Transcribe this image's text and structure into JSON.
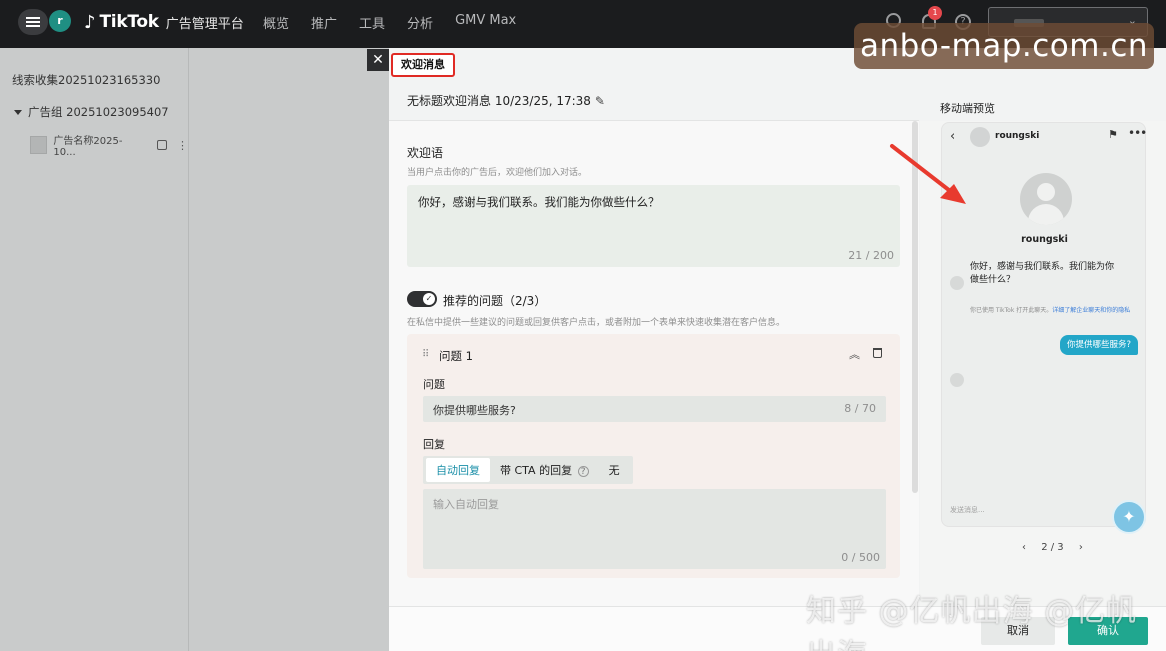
{
  "topbar": {
    "avatar_letter": "r",
    "brand": "TikTok",
    "brand_sub": "广告管理平台",
    "nav": [
      "概览",
      "推广",
      "工具",
      "分析",
      "GMV Max"
    ],
    "notification_count": "1"
  },
  "watermark_badge": "anbo-map.com.cn",
  "tree": {
    "campaign": "线索收集20251023165330",
    "ad_group": "广告组 20251023095407",
    "ad": "广告名称2025-10..."
  },
  "drawer": {
    "tab_label": "欢迎消息",
    "title": "无标题欢迎消息 10/23/25, 17:38",
    "welcome": {
      "label": "欢迎语",
      "hint": "当用户点击你的广告后，欢迎他们加入对话。",
      "text": "你好，感谢与我们联系。我们能为你做些什么？",
      "count": "21 / 200"
    },
    "suggested": {
      "label": "推荐的问题（2/3）",
      "hint": "在私信中提供一些建议的问题或回复供客户点击，或者附加一个表单来快速收集潜在客户信息。",
      "enabled": true
    },
    "question_card": {
      "title": "问题 1",
      "question_label": "问题",
      "question_value": "你提供哪些服务?",
      "question_count": "8 / 70",
      "reply_label": "回复",
      "reply_tabs": [
        "自动回复",
        "带 CTA 的回复",
        "无"
      ],
      "reply_placeholder": "输入自动回复",
      "reply_count": "0 / 500"
    },
    "footer": {
      "cancel": "取消",
      "confirm": "确认"
    }
  },
  "preview": {
    "label": "移动端预览",
    "username": "roungski",
    "message": "你好，感谢与我们联系。我们能为你做些什么？",
    "note_prefix": "你已使用 TikTok 打开此聊天。",
    "note_link": "详细了解企业聊天和你的隐私",
    "user_message": "你提供哪些服务?",
    "input_placeholder": "发送消息...",
    "pager": "2 / 3"
  },
  "bottom_watermark": "知乎 @亿帆出海 @亿帆出海"
}
